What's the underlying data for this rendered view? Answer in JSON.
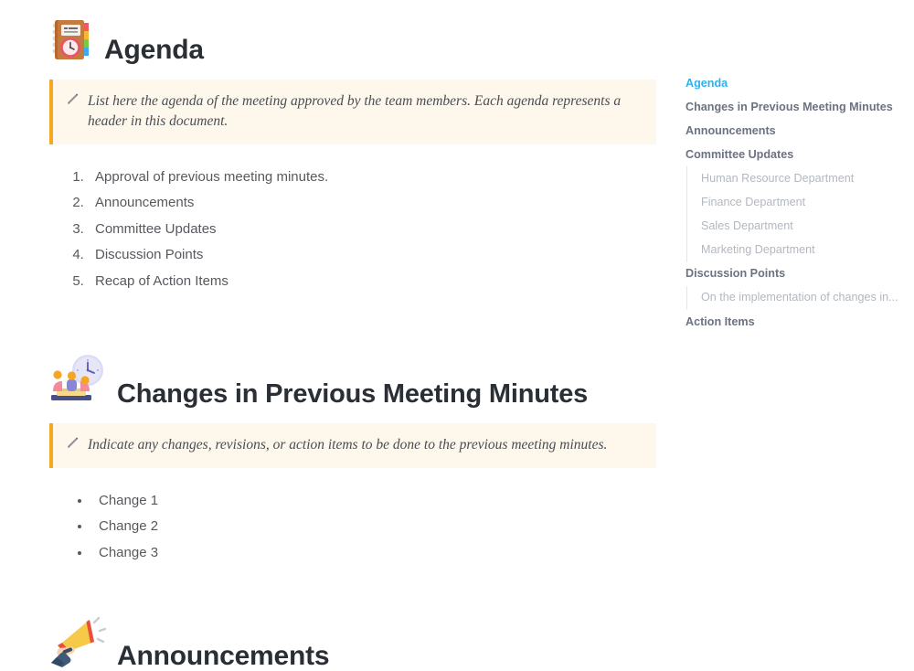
{
  "document": {
    "sections": [
      {
        "id": "agenda",
        "icon": "notebook-clock-icon",
        "title": "Agenda",
        "callout": {
          "icon": "pencil-icon",
          "text": "List here the agenda of the meeting approved by the team members. Each agenda represents a header in this document."
        },
        "list_type": "ordered",
        "items": [
          "Approval of previous meeting minutes.",
          "Announcements",
          "Committee Updates",
          "Discussion Points",
          "Recap of Action Items"
        ]
      },
      {
        "id": "changes",
        "icon": "meeting-clock-icon",
        "title": "Changes in Previous Meeting Minutes",
        "callout": {
          "icon": "pencil-icon",
          "text": "Indicate any changes, revisions, or action items to be done to the previous meeting minutes."
        },
        "list_type": "unordered",
        "items": [
          "Change 1",
          "Change 2",
          "Change 3"
        ]
      },
      {
        "id": "announcements",
        "icon": "megaphone-icon",
        "title": "Announcements",
        "callout": null,
        "list_type": "none",
        "items": []
      }
    ]
  },
  "toc": {
    "items": [
      {
        "label": "Agenda",
        "level": 0,
        "active": true
      },
      {
        "label": "Changes in Previous Meeting Minutes",
        "level": 0,
        "active": false
      },
      {
        "label": "Announcements",
        "level": 0,
        "active": false
      },
      {
        "label": "Committee Updates",
        "level": 0,
        "active": false
      },
      {
        "label": "Human Resource Department",
        "level": 1,
        "active": false
      },
      {
        "label": "Finance Department",
        "level": 1,
        "active": false
      },
      {
        "label": "Sales Department",
        "level": 1,
        "active": false
      },
      {
        "label": "Marketing Department",
        "level": 1,
        "active": false
      },
      {
        "label": "Discussion Points",
        "level": 0,
        "active": false
      },
      {
        "label": "On the implementation of changes in...",
        "level": 1,
        "active": false
      },
      {
        "label": "Action Items",
        "level": 0,
        "active": false
      }
    ]
  },
  "colors": {
    "accent_active": "#29b3f5",
    "callout_bar": "#f7a823",
    "callout_bg": "#fdf7ec",
    "heading": "#2a2e35",
    "body_text": "#56595e",
    "toc_heading": "#6b7280",
    "toc_sub": "#b3b8bf"
  }
}
